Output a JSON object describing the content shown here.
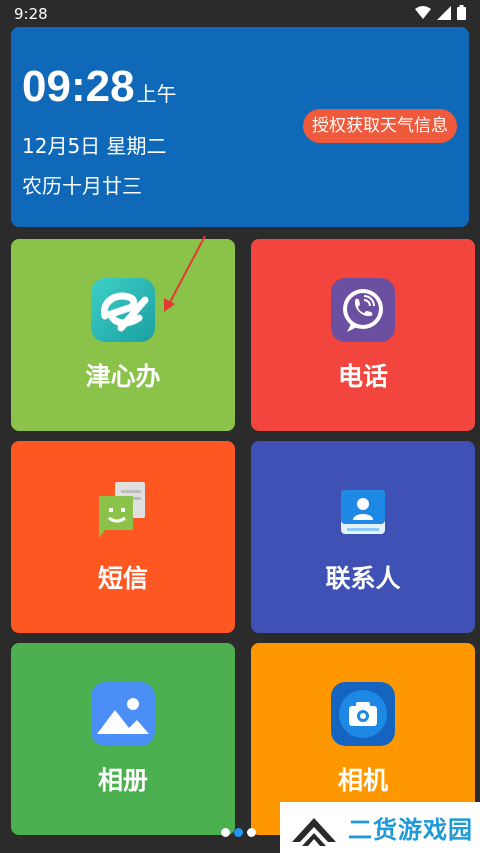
{
  "status_bar": {
    "time": "9:28",
    "icons": [
      "wifi-icon",
      "signal-icon",
      "battery-icon"
    ]
  },
  "clock_card": {
    "time": "09:28",
    "ampm": "上午",
    "date": "12月5日 星期二",
    "lunar": "农历十月廿三",
    "weather_button": "授权获取天气信息",
    "background": "#0f68b8",
    "button_color": "#f05a3c"
  },
  "tiles": [
    {
      "label": "津心办",
      "icon": "jinxinban-app-icon",
      "color": "#8bc34a"
    },
    {
      "label": "电话",
      "icon": "phone-icon",
      "color": "#f2453d"
    },
    {
      "label": "短信",
      "icon": "sms-icon",
      "color": "#ff5722"
    },
    {
      "label": "联系人",
      "icon": "contacts-icon",
      "color": "#3f51b5"
    },
    {
      "label": "相册",
      "icon": "gallery-icon",
      "color": "#4caf50"
    },
    {
      "label": "相机",
      "icon": "camera-icon",
      "color": "#ff9800"
    }
  ],
  "pager": {
    "pages": 3,
    "current": 2
  },
  "watermark": {
    "text": "二货游戏园"
  }
}
